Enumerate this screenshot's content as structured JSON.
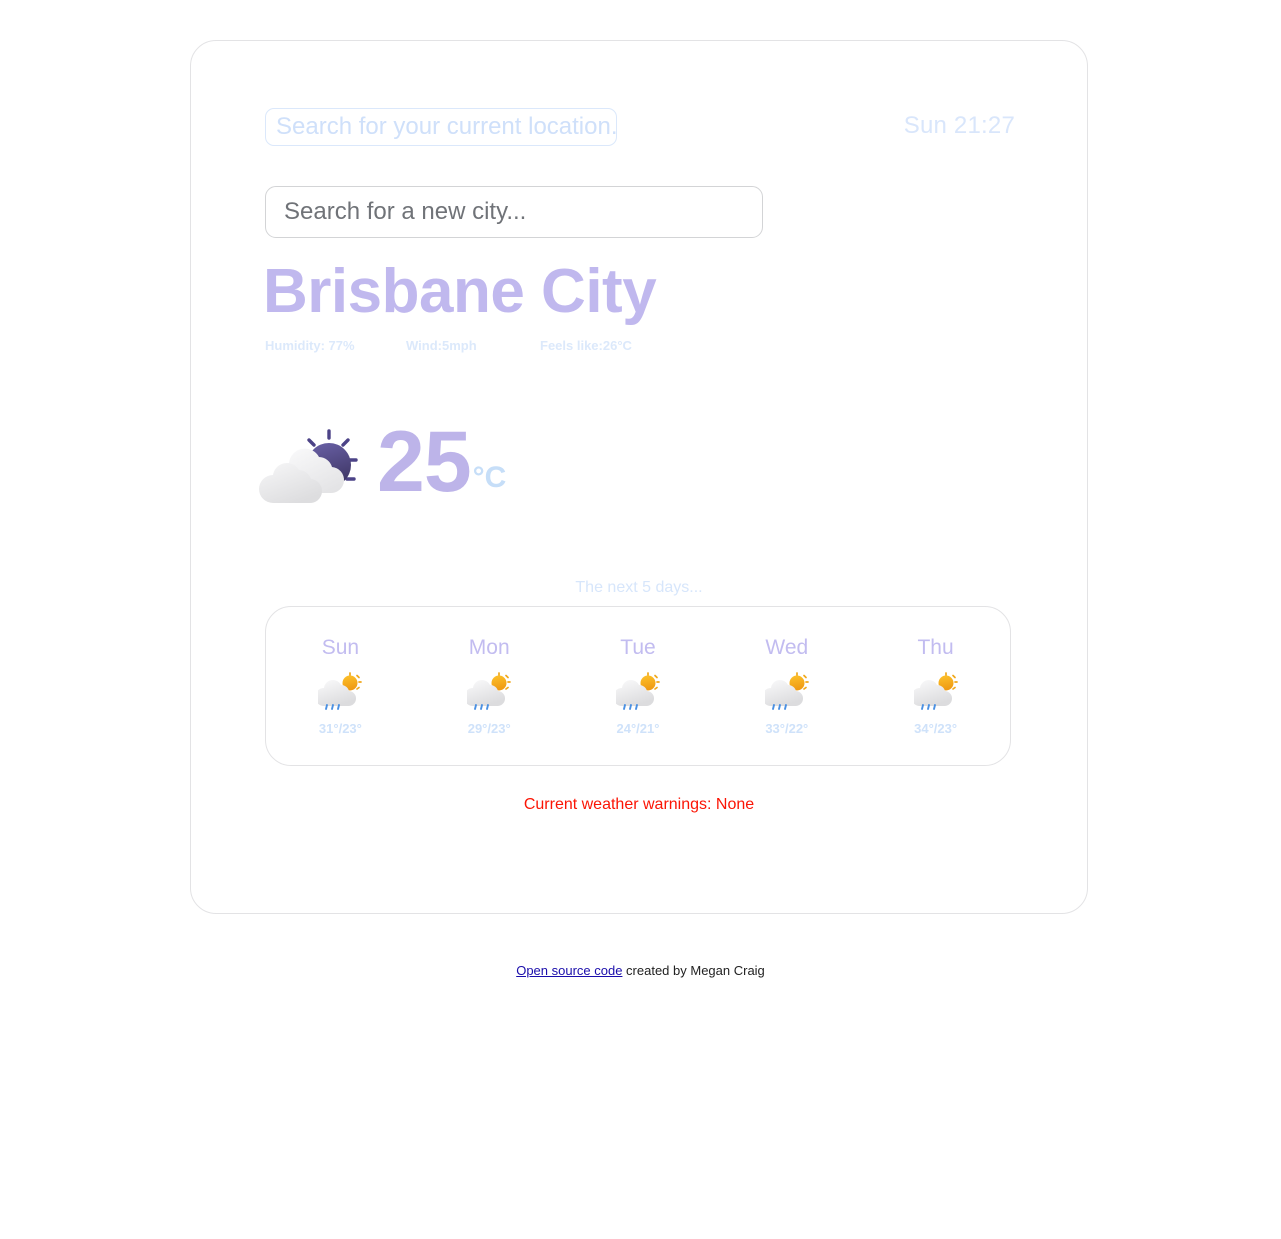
{
  "header": {
    "location_button_label": "Search for your current location...",
    "clock": "Sun 21:27"
  },
  "search": {
    "placeholder": "Search for a new city...",
    "value": ""
  },
  "current": {
    "city": "Brisbane City",
    "stats": [
      "Humidity: 77%",
      "Wind:5mph",
      "Feels like:26°C"
    ],
    "temperature": "25",
    "unit": "°C",
    "icon": "sun-behind-cloud-icon"
  },
  "forecast": {
    "heading": "The next 5 days...",
    "days": [
      {
        "name": "Sun",
        "temps": "31°/23°",
        "icon": "sun-behind-rain-cloud-icon"
      },
      {
        "name": "Mon",
        "temps": "29°/23°",
        "icon": "sun-behind-rain-cloud-icon"
      },
      {
        "name": "Tue",
        "temps": "24°/21°",
        "icon": "sun-behind-rain-cloud-icon"
      },
      {
        "name": "Wed",
        "temps": "33°/22°",
        "icon": "sun-behind-rain-cloud-icon"
      },
      {
        "name": "Thu",
        "temps": "34°/23°",
        "icon": "sun-behind-rain-cloud-icon"
      }
    ]
  },
  "warnings": {
    "text": "Current weather warnings: None"
  },
  "footer": {
    "link_text": "Open source code",
    "credit_text": " created by Megan Craig"
  },
  "colors": {
    "accent_purple": "#bdb4e9",
    "accent_blue": "#cfe2fa",
    "warning_red": "#fb1505",
    "link_blue": "#1a0dab",
    "sun_dark": "#4c4387",
    "sun_yellow": "#f5a623"
  }
}
